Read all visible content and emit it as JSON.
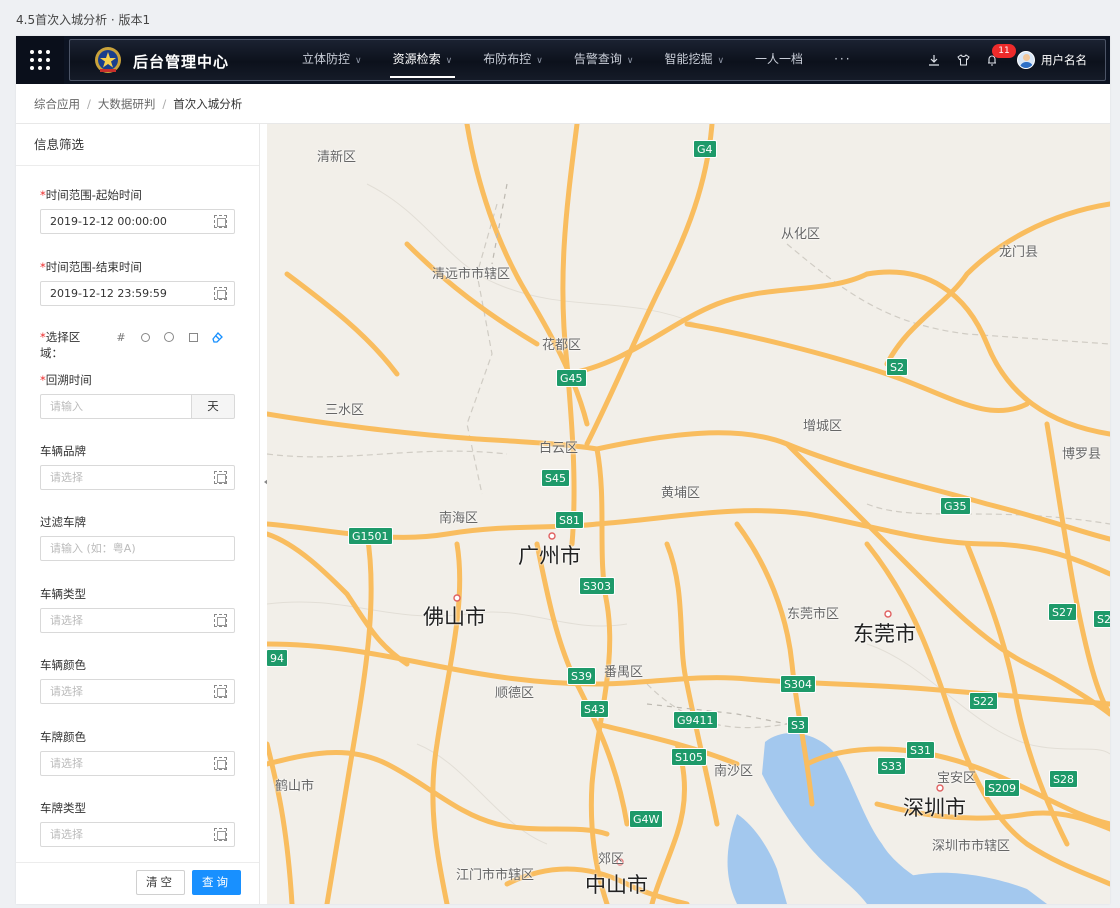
{
  "page": {
    "title": "4.5首次入城分析 · 版本1"
  },
  "topbar": {
    "app_name": "后台管理中心",
    "nav": [
      {
        "label": "立体防控",
        "has_dropdown": true,
        "active": false
      },
      {
        "label": "资源检索",
        "has_dropdown": true,
        "active": true
      },
      {
        "label": "布防布控",
        "has_dropdown": true,
        "active": false
      },
      {
        "label": "告警查询",
        "has_dropdown": true,
        "active": false
      },
      {
        "label": "智能挖掘",
        "has_dropdown": true,
        "active": false
      },
      {
        "label": "一人一档",
        "has_dropdown": false,
        "active": false
      }
    ],
    "more": "···",
    "notification_count": "11",
    "username": "用户名名",
    "icons": [
      "apps-grid-icon",
      "police-emblem-icon",
      "download-icon",
      "shirt-icon",
      "bell-icon",
      "avatar"
    ]
  },
  "breadcrumb": [
    "综合应用",
    "大数据研判",
    "首次入城分析"
  ],
  "sidebar": {
    "title": "信息筛选",
    "fields": {
      "start_time": {
        "label": "时间范围-起始时间",
        "required": true,
        "value": "2019-12-12  00:00:00"
      },
      "end_time": {
        "label": "时间范围-结束时间",
        "required": true,
        "value": "2019-12-12  23:59:59"
      },
      "area": {
        "label": "选择区域：",
        "required": true
      },
      "lookback": {
        "label": "回溯时间",
        "required": true,
        "placeholder": "请输入",
        "suffix": "天"
      },
      "brand": {
        "label": "车辆品牌",
        "placeholder": "请选择"
      },
      "filter_plate": {
        "label": "过滤车牌",
        "placeholder": "请输入 (如：粤A)"
      },
      "vehicle_type": {
        "label": "车辆类型",
        "placeholder": "请选择"
      },
      "vehicle_color": {
        "label": "车辆颜色",
        "placeholder": "请选择"
      },
      "plate_color": {
        "label": "车牌颜色",
        "placeholder": "请选择"
      },
      "plate_type": {
        "label": "车牌类型",
        "placeholder": "请选择"
      }
    },
    "clear_label": "清空",
    "query_label": "查询"
  },
  "map": {
    "districts": [
      "清新区",
      "清远市市辖区",
      "从化区",
      "龙门县",
      "花都区",
      "三水区",
      "增城区",
      "白云区",
      "博罗县",
      "黄埔区",
      "南海区",
      "东莞市区",
      "番禺区",
      "顺德区",
      "南沙区",
      "宝安区",
      "深圳市市辖区",
      "鹤山市",
      "江门市市辖区",
      "郊区"
    ],
    "cities": [
      "广州市",
      "佛山市",
      "东莞市",
      "深圳市",
      "中山市"
    ],
    "shields": [
      "G4",
      "S2",
      "G45",
      "S45",
      "G35",
      "S81",
      "G1501",
      "S303",
      "S27",
      "S2",
      "94",
      "S39",
      "S304",
      "S22",
      "S43",
      "G9411",
      "S3",
      "S31",
      "S105",
      "S33",
      "S209",
      "S28",
      "G4W"
    ],
    "colors": {
      "road": "#f9bd5f",
      "water": "#a3c8ee",
      "land": "#f2efe9",
      "shield": "#1e9a6a"
    }
  }
}
